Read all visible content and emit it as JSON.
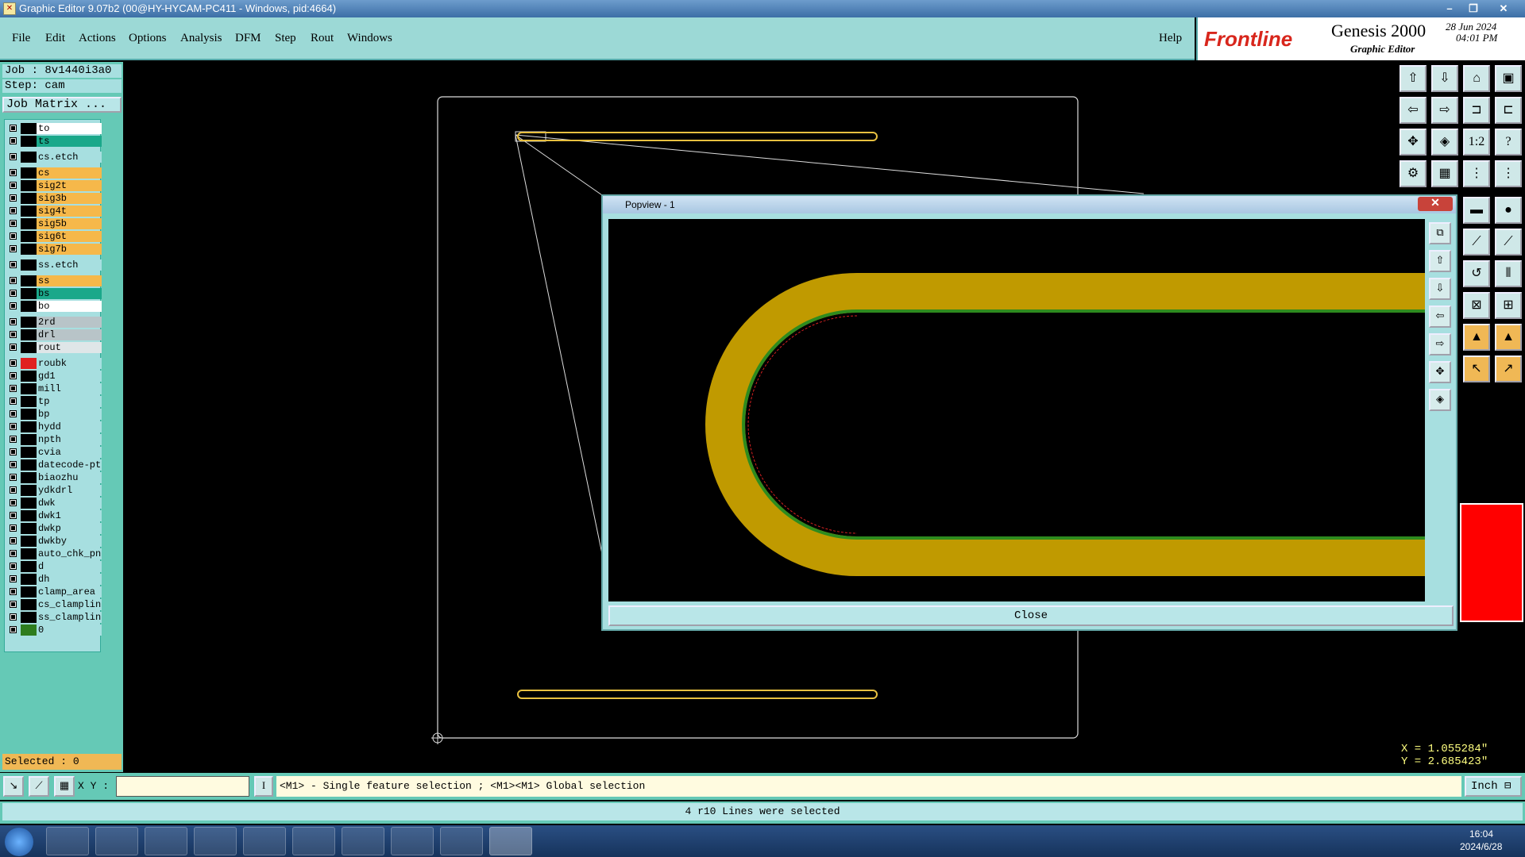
{
  "window": {
    "title": "Graphic Editor 9.07b2 (00@HY-HYCAM-PC411 - Windows, pid:4664)",
    "controls": [
      "–",
      "❐",
      "✕"
    ]
  },
  "menu": {
    "items": [
      "File",
      "Edit",
      "Actions",
      "Options",
      "Analysis",
      "DFM",
      "Step",
      "Rout",
      "Windows"
    ],
    "help": "Help"
  },
  "logo": {
    "brand": "Frontline",
    "product": "Genesis 2000",
    "subtitle": "Graphic Editor",
    "date": "28 Jun 2024",
    "time": "04:01 PM"
  },
  "job": {
    "job_label": "Job : 8v1440i3a0",
    "step_label": "Step: cam",
    "matrix_button": "Job Matrix ..."
  },
  "layers": [
    {
      "name": "to",
      "color": "#ffffff"
    },
    {
      "name": "ts",
      "color": "#1aa88a"
    },
    {
      "name": "cs.etch",
      "color": "#a7dfe0"
    },
    {
      "name": "cs",
      "color": "#f6b84a"
    },
    {
      "name": "sig2t",
      "color": "#f6b84a"
    },
    {
      "name": "sig3b",
      "color": "#f6b84a"
    },
    {
      "name": "sig4t",
      "color": "#f6b84a"
    },
    {
      "name": "sig5b",
      "color": "#f6b84a"
    },
    {
      "name": "sig6t",
      "color": "#f6b84a"
    },
    {
      "name": "sig7b",
      "color": "#f6b84a"
    },
    {
      "name": "ss.etch",
      "color": "#a7dfe0"
    },
    {
      "name": "ss",
      "color": "#f6b84a"
    },
    {
      "name": "bs",
      "color": "#1aa88a"
    },
    {
      "name": "bo",
      "color": "#ffffff"
    },
    {
      "name": "2rd",
      "color": "#b8c4c8"
    },
    {
      "name": "drl",
      "color": "#b8c4c8"
    },
    {
      "name": "rout",
      "color": "#dfe6e8"
    },
    {
      "name": "roubk",
      "color": "#a7dfe0"
    },
    {
      "name": "gd1",
      "color": "#a7dfe0"
    },
    {
      "name": "mill",
      "color": "#a7dfe0"
    },
    {
      "name": "tp",
      "color": "#a7dfe0"
    },
    {
      "name": "bp",
      "color": "#a7dfe0"
    },
    {
      "name": "hydd",
      "color": "#a7dfe0"
    },
    {
      "name": "npth",
      "color": "#a7dfe0"
    },
    {
      "name": "cvia",
      "color": "#a7dfe0"
    },
    {
      "name": "datecode-pte",
      "color": "#a7dfe0"
    },
    {
      "name": "biaozhu",
      "color": "#a7dfe0"
    },
    {
      "name": "ydkdrl",
      "color": "#a7dfe0"
    },
    {
      "name": "dwk",
      "color": "#a7dfe0"
    },
    {
      "name": "dwk1",
      "color": "#a7dfe0"
    },
    {
      "name": "dwkp",
      "color": "#a7dfe0"
    },
    {
      "name": "dwkby",
      "color": "#a7dfe0"
    },
    {
      "name": "auto_chk_pnl",
      "color": "#a7dfe0"
    },
    {
      "name": "d",
      "color": "#a7dfe0"
    },
    {
      "name": "dh",
      "color": "#a7dfe0"
    },
    {
      "name": "clamp_area",
      "color": "#a7dfe0"
    },
    {
      "name": "cs_clampline",
      "color": "#a7dfe0"
    },
    {
      "name": "ss_clampline",
      "color": "#a7dfe0"
    },
    {
      "name": "0",
      "color": "#a7dfe0"
    }
  ],
  "selected": "Selected : 0",
  "popview": {
    "title": "Popview - 1",
    "close_label": "Close"
  },
  "coords": {
    "x": "X = 1.055284\"",
    "y": "Y = 2.685423\""
  },
  "command": {
    "xy_label": "X Y :",
    "input_value": "",
    "hint": "<M1> - Single feature selection ; <M1><M1> Global selection",
    "units": "Inch"
  },
  "status": "4 r10 Lines were selected",
  "clock": {
    "time": "16:04",
    "date": "2024/6/28"
  },
  "colors": {
    "panel": "#65c9b6",
    "menu": "#9cd9d6",
    "trace": "#c09a00",
    "outline": "#e8c040"
  }
}
